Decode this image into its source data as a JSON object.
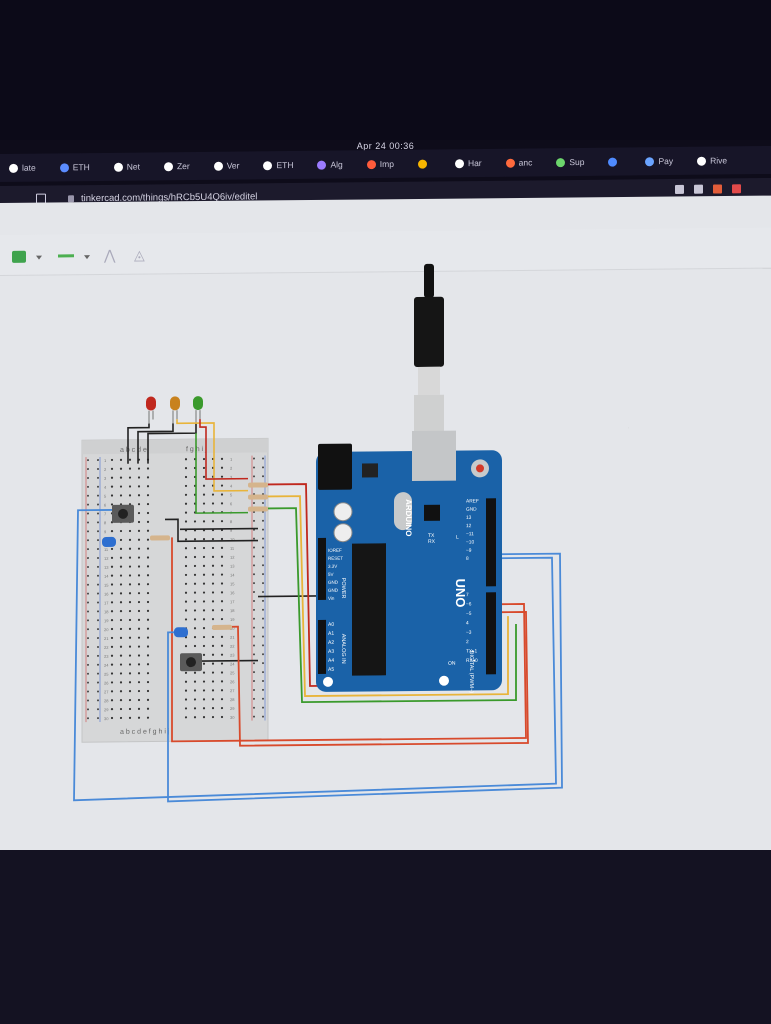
{
  "clock": "Apr 24  00:36",
  "tabs": [
    {
      "label": "late",
      "icon": "github-icon",
      "color": "#ffffff"
    },
    {
      "label": "ETH",
      "icon": "mic-icon",
      "color": "#5b8cff"
    },
    {
      "label": "Net",
      "icon": "dot-icon",
      "color": "#ffffff"
    },
    {
      "label": "Zer",
      "icon": "github-icon",
      "color": "#ffffff"
    },
    {
      "label": "Ver",
      "icon": "github-icon",
      "color": "#ffffff"
    },
    {
      "label": "ETH",
      "icon": "globe-icon",
      "color": "#ffffff"
    },
    {
      "label": "Alg",
      "icon": "p-icon",
      "color": "#9b7bff"
    },
    {
      "label": "Imp",
      "icon": "x-icon",
      "color": "#ff5b3b"
    },
    {
      "label": "",
      "icon": "grid-icon",
      "color": "#f7b500"
    },
    {
      "label": "Har",
      "icon": "chat-icon",
      "color": "#ffffff"
    },
    {
      "label": "anc",
      "icon": "shield-icon",
      "color": "#ff6a3d"
    },
    {
      "label": "Sup",
      "icon": "arrow-icon",
      "color": "#6cd66c"
    },
    {
      "label": "",
      "icon": "drop-icon",
      "color": "#4f8bff"
    },
    {
      "label": "Pay",
      "icon": "doc-icon",
      "color": "#6aa4ff"
    },
    {
      "label": "Rive",
      "icon": "rive-icon",
      "color": "#ffffff"
    }
  ],
  "address": {
    "url": "tinkercad.com/things/hRCb5U4Q6iv/editel"
  },
  "toolbar": {
    "fill_color": "#3fa34d",
    "line_color": "#4caf50"
  },
  "arduino": {
    "brand": "ARDUINO",
    "model": "UNO",
    "header_labels_power": [
      "IOREF",
      "RESET",
      "3.3V",
      "5V",
      "GND",
      "GND",
      "Vin"
    ],
    "power_title": "POWER",
    "analog_labels": [
      "A0",
      "A1",
      "A2",
      "A3",
      "A4",
      "A5"
    ],
    "analog_title": "ANALOG IN",
    "digital_labels": [
      "AREF",
      "GND",
      "13",
      "12",
      "~11",
      "~10",
      "~9",
      "8",
      "7",
      "~6",
      "~5",
      "4",
      "~3",
      "2",
      "TX▸1",
      "RX◂0"
    ],
    "digital_title": "DIGITAL (PWM~)",
    "tx": "TX",
    "rx": "RX",
    "l": "L",
    "on": "ON"
  },
  "breadboard": {
    "top_cols": "a b c d e   f g h i j",
    "bottom_cols": "a b c d e   f g h i j",
    "rows": [
      "1",
      "2",
      "3",
      "4",
      "5",
      "6",
      "7",
      "8",
      "9",
      "10",
      "11",
      "12",
      "13",
      "14",
      "15",
      "16",
      "17",
      "18",
      "19",
      "20",
      "21",
      "22",
      "23",
      "24",
      "25",
      "26",
      "27",
      "28",
      "29",
      "30"
    ]
  },
  "leds": [
    {
      "color": "#c0281e"
    },
    {
      "color": "#c8821e"
    },
    {
      "color": "#3a9a2c"
    }
  ]
}
